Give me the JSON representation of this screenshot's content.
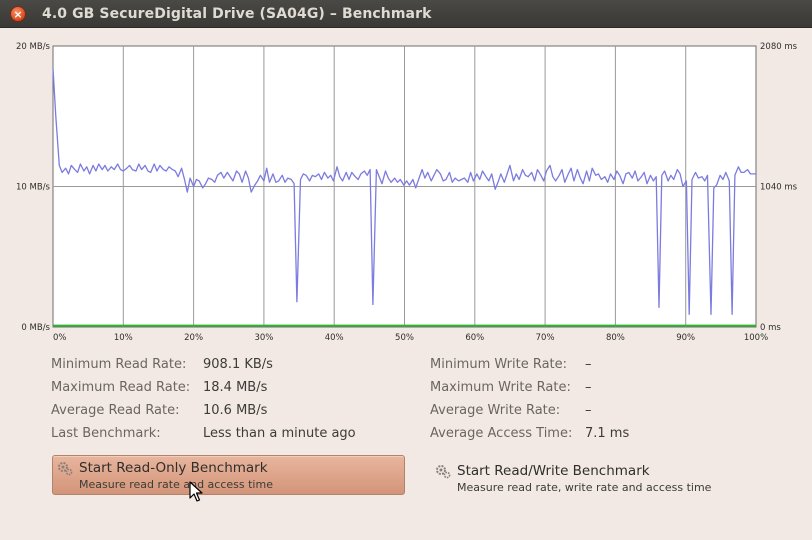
{
  "window": {
    "title": "4.0 GB SecureDigital Drive (SA04G) – Benchmark",
    "close_glyph": "×"
  },
  "chart_data": {
    "type": "line",
    "left_axis": {
      "labels": [
        "20 MB/s",
        "10 MB/s",
        "0 MB/s"
      ],
      "range": [
        0,
        20
      ],
      "unit": "MB/s"
    },
    "right_axis": {
      "labels": [
        "2080 ms",
        "1040 ms",
        "0 ms"
      ],
      "range": [
        0,
        2080
      ],
      "unit": "ms"
    },
    "x_labels": [
      "0%",
      "10%",
      "20%",
      "30%",
      "40%",
      "50%",
      "60%",
      "70%",
      "80%",
      "90%",
      "100%"
    ],
    "x_range": [
      0,
      100
    ],
    "grid": true,
    "series": [
      {
        "color": "#7b7be0",
        "axis": "left",
        "points": [
          [
            0,
            18.4
          ],
          [
            0.4,
            15
          ],
          [
            0.9,
            11.5
          ],
          [
            1.3,
            11
          ],
          [
            1.8,
            11.3
          ],
          [
            2.2,
            10.9
          ],
          [
            2.6,
            11.5
          ],
          [
            3.1,
            11.2
          ],
          [
            3.5,
            11
          ],
          [
            3.9,
            11.6
          ],
          [
            4.4,
            11.1
          ],
          [
            4.8,
            11.4
          ],
          [
            5.2,
            10.9
          ],
          [
            5.7,
            11.5
          ],
          [
            6.1,
            11.1
          ],
          [
            6.5,
            11.6
          ],
          [
            7,
            11.2
          ],
          [
            7.4,
            11.5
          ],
          [
            7.8,
            11.1
          ],
          [
            8.3,
            11.4
          ],
          [
            8.7,
            11.2
          ],
          [
            9.2,
            11.6
          ],
          [
            9.6,
            11.2
          ],
          [
            10,
            11.1
          ],
          [
            10.5,
            11.3
          ],
          [
            10.9,
            11.5
          ],
          [
            11.3,
            11.2
          ],
          [
            11.8,
            11.1
          ],
          [
            12.2,
            11.6
          ],
          [
            12.6,
            11.2
          ],
          [
            13.1,
            11.5
          ],
          [
            13.5,
            11.1
          ],
          [
            13.9,
            11
          ],
          [
            14.4,
            11.6
          ],
          [
            14.8,
            11.1
          ],
          [
            15.2,
            11.5
          ],
          [
            15.7,
            11.2
          ],
          [
            16.1,
            11.1
          ],
          [
            16.5,
            11.4
          ],
          [
            17,
            11.2
          ],
          [
            17.4,
            11.1
          ],
          [
            17.8,
            10.7
          ],
          [
            18.3,
            11.3
          ],
          [
            18.7,
            10.5
          ],
          [
            19.1,
            9.6
          ],
          [
            19.5,
            10.6
          ],
          [
            20,
            10
          ],
          [
            20.4,
            10.5
          ],
          [
            20.8,
            10.4
          ],
          [
            21.3,
            9.9
          ],
          [
            21.7,
            10.2
          ],
          [
            22.1,
            10.6
          ],
          [
            22.6,
            10.5
          ],
          [
            23,
            10.3
          ],
          [
            23.4,
            10.8
          ],
          [
            23.9,
            11
          ],
          [
            24.3,
            10.6
          ],
          [
            24.8,
            11
          ],
          [
            25.2,
            10.7
          ],
          [
            25.6,
            10.4
          ],
          [
            26.1,
            11.1
          ],
          [
            26.5,
            10.9
          ],
          [
            26.9,
            10.3
          ],
          [
            27.4,
            11.1
          ],
          [
            27.8,
            10.6
          ],
          [
            28.2,
            9.6
          ],
          [
            28.7,
            10.1
          ],
          [
            29.1,
            10.4
          ],
          [
            29.5,
            10.8
          ],
          [
            30,
            10.4
          ],
          [
            30.4,
            11.3
          ],
          [
            30.8,
            10.3
          ],
          [
            31.3,
            10.9
          ],
          [
            31.7,
            10.3
          ],
          [
            32.1,
            10.4
          ],
          [
            32.6,
            10.8
          ],
          [
            33,
            10.3
          ],
          [
            33.4,
            10.6
          ],
          [
            33.9,
            10.5
          ],
          [
            34.3,
            10.2
          ],
          [
            34.7,
            1.8
          ],
          [
            35.2,
            10.5
          ],
          [
            35.6,
            10.9
          ],
          [
            36,
            10.8
          ],
          [
            36.5,
            10.4
          ],
          [
            36.9,
            10.8
          ],
          [
            37.3,
            10.7
          ],
          [
            37.8,
            10.9
          ],
          [
            38.2,
            10.5
          ],
          [
            38.6,
            11
          ],
          [
            39.1,
            10.6
          ],
          [
            39.5,
            10.8
          ],
          [
            39.9,
            10.4
          ],
          [
            40.4,
            11.4
          ],
          [
            40.8,
            10.7
          ],
          [
            41.2,
            10.4
          ],
          [
            41.7,
            11
          ],
          [
            42.1,
            10.5
          ],
          [
            42.5,
            11
          ],
          [
            43,
            10.7
          ],
          [
            43.4,
            10.5
          ],
          [
            43.8,
            10.9
          ],
          [
            44.3,
            11.1
          ],
          [
            44.7,
            10.8
          ],
          [
            45.1,
            11.2
          ],
          [
            45.5,
            1.6
          ],
          [
            46,
            11.2
          ],
          [
            46.4,
            10.7
          ],
          [
            46.8,
            10.2
          ],
          [
            47.3,
            11.1
          ],
          [
            47.7,
            10.6
          ],
          [
            48.1,
            10.3
          ],
          [
            48.6,
            10.6
          ],
          [
            49,
            10.3
          ],
          [
            49.4,
            10.5
          ],
          [
            49.9,
            10.1
          ],
          [
            50.3,
            10.4
          ],
          [
            50.7,
            10.1
          ],
          [
            51.2,
            10.5
          ],
          [
            51.6,
            9.9
          ],
          [
            52,
            10.5
          ],
          [
            52.5,
            11.2
          ],
          [
            52.9,
            10.6
          ],
          [
            53.3,
            11
          ],
          [
            53.8,
            10.4
          ],
          [
            54.2,
            10.8
          ],
          [
            54.6,
            11.2
          ],
          [
            55.1,
            10.9
          ],
          [
            55.5,
            10.4
          ],
          [
            55.9,
            10.5
          ],
          [
            56.4,
            11
          ],
          [
            56.8,
            10.3
          ],
          [
            57.2,
            10.6
          ],
          [
            57.7,
            10.4
          ],
          [
            58.1,
            10.5
          ],
          [
            58.5,
            10.6
          ],
          [
            59,
            10.3
          ],
          [
            59.4,
            11
          ],
          [
            59.8,
            10.4
          ],
          [
            60.3,
            10.9
          ],
          [
            60.7,
            10.5
          ],
          [
            61.1,
            11.1
          ],
          [
            61.6,
            10.7
          ],
          [
            62,
            10.4
          ],
          [
            62.4,
            10.9
          ],
          [
            62.9,
            9.8
          ],
          [
            63.3,
            10.3
          ],
          [
            63.7,
            10.9
          ],
          [
            64.2,
            10.3
          ],
          [
            64.6,
            10.9
          ],
          [
            65,
            11.5
          ],
          [
            65.5,
            10.4
          ],
          [
            65.9,
            10.9
          ],
          [
            66.3,
            10.5
          ],
          [
            66.8,
            11.2
          ],
          [
            67.2,
            10.8
          ],
          [
            67.6,
            10.7
          ],
          [
            68.1,
            11
          ],
          [
            68.5,
            10.4
          ],
          [
            68.9,
            11.2
          ],
          [
            69.4,
            10.8
          ],
          [
            69.8,
            10.4
          ],
          [
            70.2,
            11.1
          ],
          [
            70.7,
            11.5
          ],
          [
            71.1,
            10.7
          ],
          [
            71.5,
            10.4
          ],
          [
            72,
            10.8
          ],
          [
            72.4,
            11.2
          ],
          [
            72.8,
            10.3
          ],
          [
            73.3,
            10.9
          ],
          [
            73.7,
            11.3
          ],
          [
            74.1,
            10.4
          ],
          [
            74.6,
            11.2
          ],
          [
            75,
            10.6
          ],
          [
            75.4,
            10.2
          ],
          [
            75.9,
            11.1
          ],
          [
            76.3,
            10.4
          ],
          [
            76.7,
            11.3
          ],
          [
            77.2,
            10.8
          ],
          [
            77.6,
            10.9
          ],
          [
            78,
            10.5
          ],
          [
            78.5,
            10.7
          ],
          [
            78.9,
            10.3
          ],
          [
            79.3,
            10.9
          ],
          [
            79.8,
            10.5
          ],
          [
            80.2,
            11.1
          ],
          [
            80.6,
            10.8
          ],
          [
            81.1,
            10.2
          ],
          [
            81.5,
            10.9
          ],
          [
            81.9,
            11
          ],
          [
            82.4,
            10.6
          ],
          [
            82.8,
            11.1
          ],
          [
            83.2,
            10.4
          ],
          [
            83.7,
            10.7
          ],
          [
            84.1,
            11
          ],
          [
            84.5,
            10.2
          ],
          [
            85,
            10.8
          ],
          [
            85.4,
            10.4
          ],
          [
            85.8,
            10.7
          ],
          [
            86.2,
            1.4
          ],
          [
            86.6,
            10.8
          ],
          [
            87,
            11.1
          ],
          [
            87.5,
            10.4
          ],
          [
            87.9,
            10.8
          ],
          [
            88.3,
            10.5
          ],
          [
            88.8,
            11.2
          ],
          [
            89.2,
            10.9
          ],
          [
            89.6,
            10
          ],
          [
            90.1,
            10.4
          ],
          [
            90.5,
            0.9
          ],
          [
            90.9,
            10.5
          ],
          [
            91.4,
            11
          ],
          [
            91.8,
            10.6
          ],
          [
            92.3,
            10.7
          ],
          [
            92.7,
            10.4
          ],
          [
            93.1,
            10.8
          ],
          [
            93.6,
            0.9
          ],
          [
            94,
            9.9
          ],
          [
            94.4,
            10.1
          ],
          [
            94.9,
            10.8
          ],
          [
            95.3,
            10.5
          ],
          [
            95.7,
            11
          ],
          [
            96.2,
            10.4
          ],
          [
            96.6,
            0.9
          ],
          [
            97,
            10.8
          ],
          [
            97.5,
            11.4
          ],
          [
            97.9,
            11
          ],
          [
            98.3,
            11
          ],
          [
            98.8,
            11.2
          ],
          [
            99.2,
            10.9
          ],
          [
            99.6,
            10.9
          ],
          [
            100,
            10.9
          ]
        ]
      },
      {
        "color": "#2db52d",
        "axis": "left",
        "points": [
          [
            0,
            0.1
          ],
          [
            100,
            0.1
          ]
        ]
      }
    ]
  },
  "stats": {
    "read": [
      {
        "label": "Minimum Read Rate:",
        "value": "908.1 KB/s"
      },
      {
        "label": "Maximum Read Rate:",
        "value": "18.4 MB/s"
      },
      {
        "label": "Average Read Rate:",
        "value": "10.6 MB/s"
      },
      {
        "label": "Last Benchmark:",
        "value": "Less than a minute ago"
      }
    ],
    "write": [
      {
        "label": "Minimum Write Rate:",
        "value": "–"
      },
      {
        "label": "Maximum Write Rate:",
        "value": "–"
      },
      {
        "label": "Average Write Rate:",
        "value": "–"
      },
      {
        "label": "Average Access Time:",
        "value": "7.1 ms"
      }
    ]
  },
  "buttons": {
    "read_only": {
      "title": "Start Read-Only Benchmark",
      "subtitle": "Measure read rate and access time",
      "icon": "gears-icon"
    },
    "read_write": {
      "title": "Start Read/Write Benchmark",
      "subtitle": "Measure read rate, write rate and access time",
      "icon": "gears-icon"
    }
  }
}
